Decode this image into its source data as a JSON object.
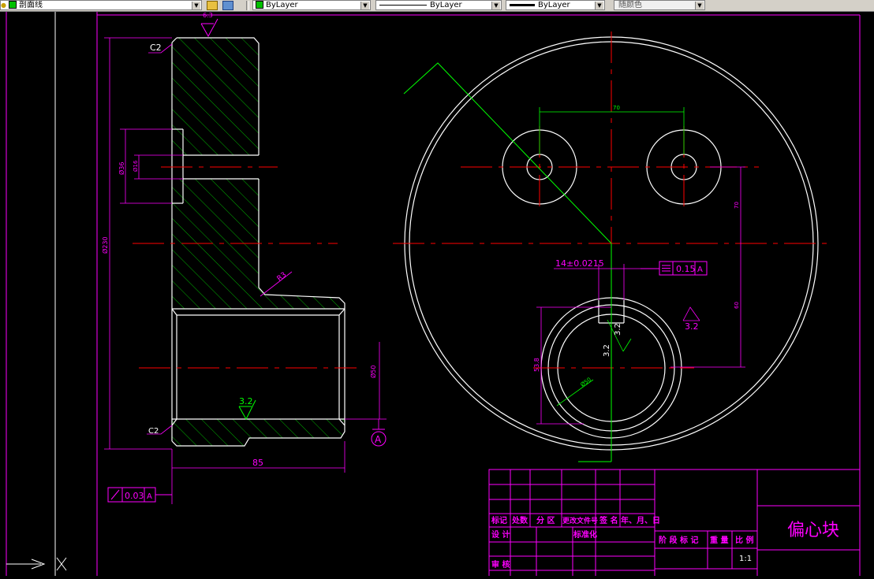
{
  "toolbar": {
    "layer_name": "剖面线",
    "color_value": "ByLayer",
    "linetype_value": "ByLayer",
    "lineweight_value": "ByLayer",
    "plotstyle_value": "随颜色"
  },
  "drawing": {
    "chamfer_top": "C2",
    "chamfer_bottom": "C2",
    "dim_bore": "Ø36",
    "dim_hole": "Ø16",
    "dim_overall_dia": "Ø230",
    "dim_radius": "R3",
    "roughness_top": "6.3",
    "roughness_inner": "3.2",
    "roughness_key": "3.2",
    "roughness_key_right": "3.2",
    "roughness_keyway": "3.2",
    "dim_shaft_bore": "Ø50",
    "dim_length": "85",
    "datum_label": "A",
    "gtol_runout_value": "0.03",
    "gtol_runout_datum": "A",
    "dim_hole_spacing": "70",
    "dim_vertical_upper": "70",
    "dim_vertical_lower": "60",
    "dim_keyway_width": "14±0.0215",
    "gtol_sym_value": "0.15",
    "gtol_sym_datum": "A",
    "dim_keyway_depth": "53.8",
    "dim_bore_right": "Ø50"
  },
  "title_block": {
    "part_name": "偏心块",
    "col_mark": "标记",
    "col_count": "处数",
    "col_zone": "分 区",
    "col_doc": "更改文件号",
    "col_sign": "签 名",
    "col_date": "年、月、日",
    "row_design": "设 计",
    "row_standard": "标准化",
    "row_review": "审 核",
    "stage_mark": "阶 段 标 记",
    "weight": "重 量",
    "scale_label": "比 例",
    "scale_value": "1:1"
  }
}
